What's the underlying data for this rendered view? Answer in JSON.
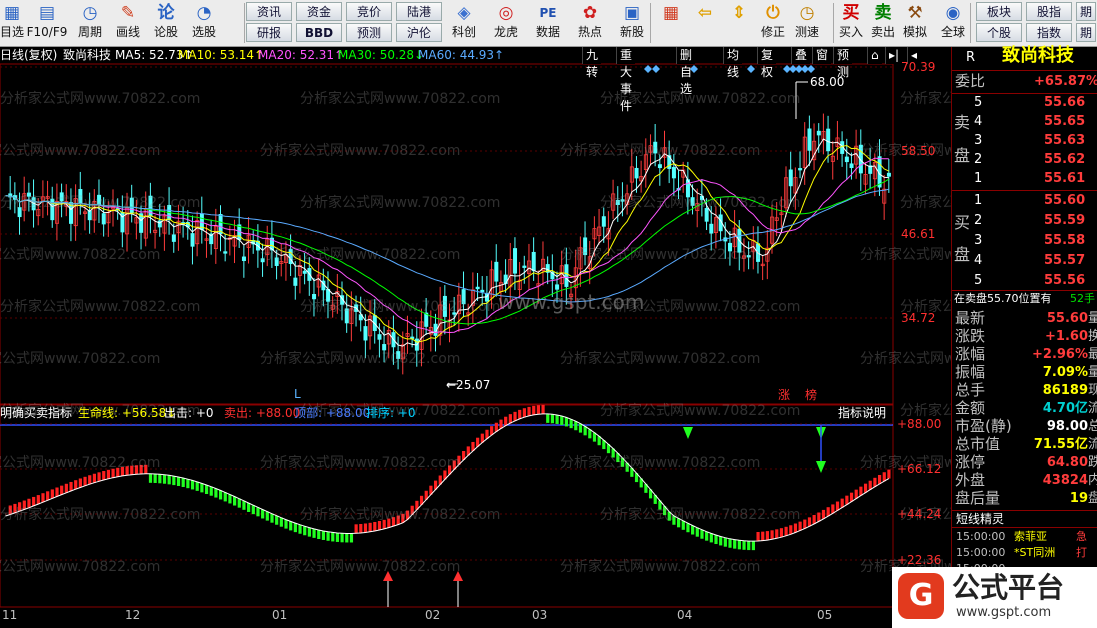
{
  "toolbar": {
    "items": [
      {
        "label": "目选",
        "icon": "chart-icon"
      },
      {
        "label": "F10/F9",
        "icon": "info-icon"
      },
      {
        "label": "周期",
        "icon": "clock-icon"
      },
      {
        "label": "画线",
        "icon": "pencil-icon"
      },
      {
        "label": "论股",
        "icon": "comment-icon"
      },
      {
        "label": "选股",
        "icon": "gauge-icon"
      }
    ],
    "small_buttons": [
      [
        "资讯",
        "研报"
      ],
      [
        "资金",
        "BBD"
      ],
      [
        "竞价",
        "预测"
      ],
      [
        "陆港",
        "沪伦"
      ]
    ],
    "big_items": [
      {
        "label": "科创",
        "icon": "kechuang-icon"
      },
      {
        "label": "龙虎",
        "icon": "dragon-icon"
      },
      {
        "label": "数据",
        "icon": "pe-icon"
      },
      {
        "label": "热点",
        "icon": "hot-icon"
      },
      {
        "label": "新股",
        "icon": "newstock-icon"
      }
    ],
    "nav_items": [
      {
        "label": "",
        "icon": "grid-icon"
      },
      {
        "label": "",
        "icon": "back-arrow-icon"
      },
      {
        "label": "",
        "icon": "updown-icon"
      },
      {
        "label": "修正",
        "icon": "power-icon"
      },
      {
        "label": "测速",
        "icon": "speed-icon"
      }
    ],
    "trade_items": [
      {
        "label": "买入",
        "icon": "buy-icon"
      },
      {
        "label": "卖出",
        "icon": "sell-icon"
      },
      {
        "label": "模拟",
        "icon": "hammer-icon"
      },
      {
        "label": "全球",
        "icon": "globe-icon"
      }
    ],
    "right_buttons": [
      [
        "板块",
        "个股"
      ],
      [
        "股指",
        "指数"
      ],
      [
        "期",
        "期"
      ]
    ]
  },
  "chart_header": {
    "period": "日线(复权)",
    "stock_name": "致尚科技",
    "ma": [
      {
        "label": "MA5: 52.73↑",
        "color": "#ffffff"
      },
      {
        "label": "MA10: 53.14↑",
        "color": "#ffff00"
      },
      {
        "label": "MA20: 52.31↑",
        "color": "#ff55ff"
      },
      {
        "label": "MA30: 50.28↓",
        "color": "#00ff00"
      },
      {
        "label": "MA60: 44.93↑",
        "color": "#5aaaff"
      }
    ],
    "buttons": [
      "九转",
      "重大事件",
      "删自选",
      "均线",
      "复权",
      "叠",
      "窗",
      "预测"
    ]
  },
  "indicator_header": {
    "title": "明确买卖指标",
    "items": [
      {
        "label": "生命线: +56.58↓",
        "color": "#ffff00"
      },
      {
        "label": "出击: +0",
        "color": "#ffffff"
      },
      {
        "label": "卖出: +88.00",
        "color": "#ff3030"
      },
      {
        "label": "顶部: +88.00",
        "color": "#4a7cff"
      },
      {
        "label": "排序: +0",
        "color": "#00d0ff"
      }
    ],
    "help_button": "指标说明"
  },
  "price_axis": [
    "70.39",
    "58.50",
    "46.61",
    "34.72"
  ],
  "indicator_axis": [
    "+88.00",
    "+66.12",
    "+44.24",
    "+22.36"
  ],
  "date_axis": [
    "11",
    "12",
    "01",
    "02",
    "03",
    "04",
    "05"
  ],
  "annotations": {
    "high": "68.00",
    "low": "25.07",
    "marker_l": "L",
    "tag_zhang": "涨",
    "tag_bang": "榜"
  },
  "watermark": "www.gspt.com",
  "repeat_watermark": "分析家公式网www.70822.com",
  "right_panel": {
    "logo": "R",
    "stock_name": "致尚科技",
    "weibi_label": "委比",
    "weibi_value": "+65.87%",
    "sell_label": [
      "卖",
      "盘"
    ],
    "buy_label": [
      "买",
      "盘"
    ],
    "sell_orders": [
      {
        "level": "5",
        "price": "55.66"
      },
      {
        "level": "4",
        "price": "55.65"
      },
      {
        "level": "3",
        "price": "55.63"
      },
      {
        "level": "2",
        "price": "55.62"
      },
      {
        "level": "1",
        "price": "55.61"
      }
    ],
    "buy_orders": [
      {
        "level": "1",
        "price": "55.60"
      },
      {
        "level": "2",
        "price": "55.59"
      },
      {
        "level": "3",
        "price": "55.58"
      },
      {
        "level": "4",
        "price": "55.57"
      },
      {
        "level": "5",
        "price": "55.56"
      }
    ],
    "notice": "在卖盘55.70位置有",
    "notice_num": "52手",
    "stats": [
      {
        "label": "最新",
        "value": "55.60",
        "color": "#ff3c3c"
      },
      {
        "label": "涨跌",
        "value": "+1.60",
        "color": "#ff3c3c"
      },
      {
        "label": "涨幅",
        "value": "+2.96%",
        "color": "#ff3c3c"
      },
      {
        "label": "振幅",
        "value": "7.09%",
        "color": "#ffff00"
      },
      {
        "label": "总手",
        "value": "86189",
        "color": "#ffff00"
      },
      {
        "label": "金额",
        "value": "4.70亿",
        "color": "#00d0d0"
      },
      {
        "label": "市盈(静)",
        "value": "98.00",
        "color": "#ffffff"
      },
      {
        "label": "总市值",
        "value": "71.55亿",
        "color": "#ffff00"
      },
      {
        "label": "涨停",
        "value": "64.80",
        "color": "#ff3c3c"
      },
      {
        "label": "外盘",
        "value": "43824",
        "color": "#ff3c3c"
      },
      {
        "label": "盘后量",
        "value": "19",
        "color": "#ffff00"
      }
    ],
    "stats_suffix": [
      "量",
      "换",
      "最",
      "量",
      "现",
      "流",
      "总",
      "流",
      "跌",
      "内",
      "盘"
    ],
    "short_title": "短线精灵",
    "short_rows": [
      {
        "time": "15:00:00",
        "name": "索菲亚",
        "event": "急"
      },
      {
        "time": "15:00:00",
        "name": "*ST同洲",
        "event": "打"
      },
      {
        "time": "15:00:00",
        "name": "",
        "event": ""
      }
    ]
  },
  "brand": {
    "name": "公式平台",
    "url": "www.gspt.com"
  }
}
